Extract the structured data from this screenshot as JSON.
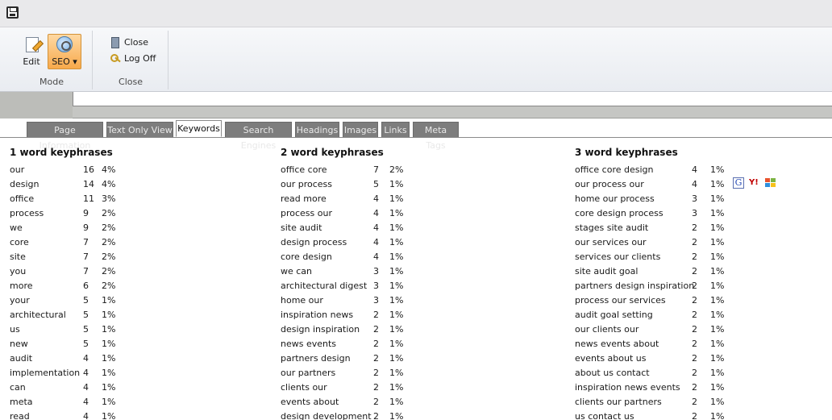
{
  "ribbon": {
    "mode_group": {
      "label": "Mode",
      "edit_label": "Edit",
      "seo_label": "SEO ▾"
    },
    "close_group": {
      "label": "Close",
      "close_label": "Close",
      "logoff_label": "Log Off"
    }
  },
  "tabs": [
    {
      "label": "Page Information"
    },
    {
      "label": "Text Only View"
    },
    {
      "label": "Keywords"
    },
    {
      "label": "Search Engines"
    },
    {
      "label": "Headings"
    },
    {
      "label": "Images"
    },
    {
      "label": "Links"
    },
    {
      "label": "Meta Tags"
    }
  ],
  "active_tab": "Keywords",
  "colors": {
    "accent": "#f7a94b",
    "tab_inactive": "#7d7d7d",
    "ribbon_bg": "#e9ecf1"
  },
  "search_engine_icons": {
    "google": "G",
    "yahoo": "Y!",
    "msn": "windows-flag-icon"
  },
  "keywords": {
    "one_word": {
      "title": "1 word keyphrases",
      "rows": [
        {
          "phrase": "our",
          "count": "16",
          "pct": "4%"
        },
        {
          "phrase": "design",
          "count": "14",
          "pct": "4%"
        },
        {
          "phrase": "office",
          "count": "11",
          "pct": "3%"
        },
        {
          "phrase": "process",
          "count": "9",
          "pct": "2%"
        },
        {
          "phrase": "we",
          "count": "9",
          "pct": "2%"
        },
        {
          "phrase": "core",
          "count": "7",
          "pct": "2%"
        },
        {
          "phrase": "site",
          "count": "7",
          "pct": "2%"
        },
        {
          "phrase": "you",
          "count": "7",
          "pct": "2%"
        },
        {
          "phrase": "more",
          "count": "6",
          "pct": "2%"
        },
        {
          "phrase": "your",
          "count": "5",
          "pct": "1%"
        },
        {
          "phrase": "architectural",
          "count": "5",
          "pct": "1%"
        },
        {
          "phrase": "us",
          "count": "5",
          "pct": "1%"
        },
        {
          "phrase": "new",
          "count": "5",
          "pct": "1%"
        },
        {
          "phrase": "audit",
          "count": "4",
          "pct": "1%"
        },
        {
          "phrase": "implementation",
          "count": "4",
          "pct": "1%"
        },
        {
          "phrase": "can",
          "count": "4",
          "pct": "1%"
        },
        {
          "phrase": "meta",
          "count": "4",
          "pct": "1%"
        },
        {
          "phrase": "read",
          "count": "4",
          "pct": "1%"
        }
      ]
    },
    "two_word": {
      "title": "2 word keyphrases",
      "rows": [
        {
          "phrase": "office core",
          "count": "7",
          "pct": "2%"
        },
        {
          "phrase": "our process",
          "count": "5",
          "pct": "1%"
        },
        {
          "phrase": "read more",
          "count": "4",
          "pct": "1%"
        },
        {
          "phrase": "process our",
          "count": "4",
          "pct": "1%"
        },
        {
          "phrase": "site audit",
          "count": "4",
          "pct": "1%"
        },
        {
          "phrase": "design process",
          "count": "4",
          "pct": "1%"
        },
        {
          "phrase": "core design",
          "count": "4",
          "pct": "1%"
        },
        {
          "phrase": "we can",
          "count": "3",
          "pct": "1%"
        },
        {
          "phrase": "architectural digest",
          "count": "3",
          "pct": "1%"
        },
        {
          "phrase": "home our",
          "count": "3",
          "pct": "1%"
        },
        {
          "phrase": "inspiration news",
          "count": "2",
          "pct": "1%"
        },
        {
          "phrase": "design inspiration",
          "count": "2",
          "pct": "1%"
        },
        {
          "phrase": "news events",
          "count": "2",
          "pct": "1%"
        },
        {
          "phrase": "partners design",
          "count": "2",
          "pct": "1%"
        },
        {
          "phrase": "our partners",
          "count": "2",
          "pct": "1%"
        },
        {
          "phrase": "clients our",
          "count": "2",
          "pct": "1%"
        },
        {
          "phrase": "events about",
          "count": "2",
          "pct": "1%"
        },
        {
          "phrase": "design development",
          "count": "2",
          "pct": "1%"
        }
      ]
    },
    "three_word": {
      "title": "3 word keyphrases",
      "rows": [
        {
          "phrase": "office core design",
          "count": "4",
          "pct": "1%"
        },
        {
          "phrase": "our process our",
          "count": "4",
          "pct": "1%"
        },
        {
          "phrase": "home our process",
          "count": "3",
          "pct": "1%"
        },
        {
          "phrase": "core design process",
          "count": "3",
          "pct": "1%"
        },
        {
          "phrase": "stages site audit",
          "count": "2",
          "pct": "1%"
        },
        {
          "phrase": "our services our",
          "count": "2",
          "pct": "1%"
        },
        {
          "phrase": "services our clients",
          "count": "2",
          "pct": "1%"
        },
        {
          "phrase": "site audit goal",
          "count": "2",
          "pct": "1%"
        },
        {
          "phrase": "partners design inspiration",
          "count": "2",
          "pct": "1%"
        },
        {
          "phrase": "process our services",
          "count": "2",
          "pct": "1%"
        },
        {
          "phrase": "audit goal setting",
          "count": "2",
          "pct": "1%"
        },
        {
          "phrase": "our clients our",
          "count": "2",
          "pct": "1%"
        },
        {
          "phrase": "news events about",
          "count": "2",
          "pct": "1%"
        },
        {
          "phrase": "events about us",
          "count": "2",
          "pct": "1%"
        },
        {
          "phrase": "about us contact",
          "count": "2",
          "pct": "1%"
        },
        {
          "phrase": "inspiration news events",
          "count": "2",
          "pct": "1%"
        },
        {
          "phrase": "clients our partners",
          "count": "2",
          "pct": "1%"
        },
        {
          "phrase": "us contact us",
          "count": "2",
          "pct": "1%"
        }
      ]
    }
  }
}
